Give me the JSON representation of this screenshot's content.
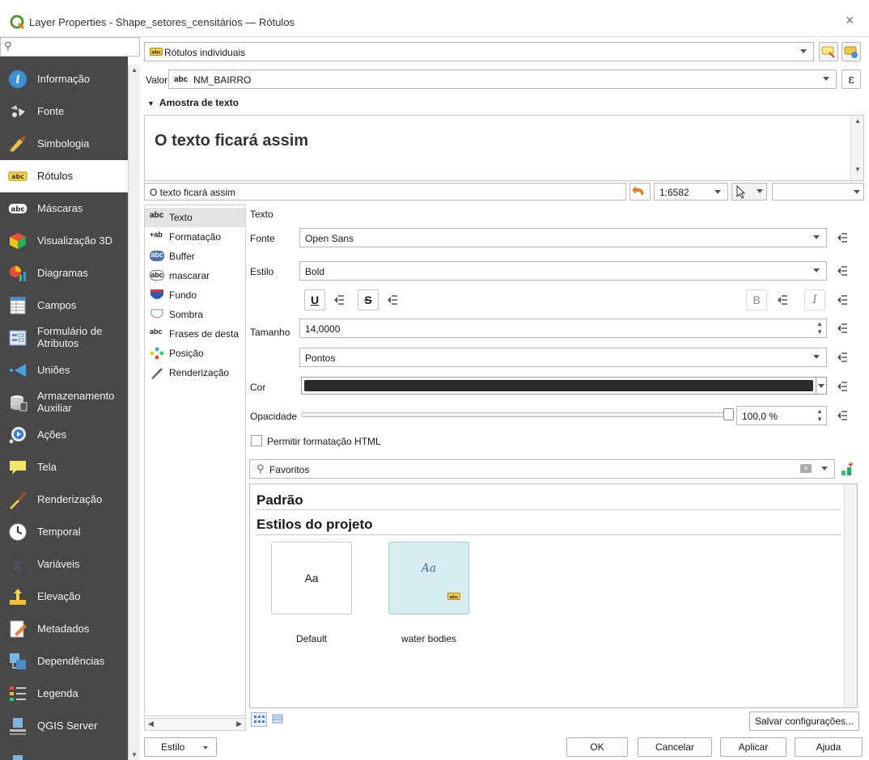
{
  "window": {
    "title": "Layer Properties - Shape_setores_censitários — Rótulos",
    "search_placeholder": ""
  },
  "sidebar": {
    "items": [
      {
        "label": "Informação",
        "icon": "info-icon"
      },
      {
        "label": "Fonte",
        "icon": "source-icon"
      },
      {
        "label": "Simbologia",
        "icon": "symbology-icon"
      },
      {
        "label": "Rótulos",
        "icon": "labels-icon"
      },
      {
        "label": "Máscaras",
        "icon": "masks-icon"
      },
      {
        "label": "Visualização 3D",
        "icon": "3d-icon"
      },
      {
        "label": "Diagramas",
        "icon": "diagrams-icon"
      },
      {
        "label": "Campos",
        "icon": "fields-icon"
      },
      {
        "label": "Formulário de",
        "label2": "Atributos",
        "icon": "form-icon"
      },
      {
        "label": "Uniões",
        "icon": "joins-icon"
      },
      {
        "label": "Armazenamento",
        "label2": "Auxiliar",
        "icon": "storage-icon"
      },
      {
        "label": "Ações",
        "icon": "actions-icon"
      },
      {
        "label": "Tela",
        "icon": "display-icon"
      },
      {
        "label": "Renderização",
        "icon": "rendering-icon"
      },
      {
        "label": "Temporal",
        "icon": "temporal-icon"
      },
      {
        "label": "Variáveis",
        "icon": "variables-icon"
      },
      {
        "label": "Elevação",
        "icon": "elevation-icon"
      },
      {
        "label": "Metadados",
        "icon": "metadata-icon"
      },
      {
        "label": "Dependências",
        "icon": "dependencies-icon"
      },
      {
        "label": "Legenda",
        "icon": "legend-icon"
      },
      {
        "label": "QGIS Server",
        "icon": "server-icon"
      }
    ],
    "active": "Rótulos"
  },
  "labels": {
    "mode": "Rótulos individuais",
    "value_label": "Valor",
    "value_field": "NM_BAIRRO",
    "sample_heading": "Amostra de texto",
    "preview_text": "O texto ficará assim",
    "preview_input": "O texto ficará assim",
    "scale": "1:6582"
  },
  "subtree": {
    "items": [
      {
        "label": "Texto",
        "icon": "abc"
      },
      {
        "label": "Formatação",
        "icon": "+ab"
      },
      {
        "label": "Buffer",
        "icon": "abc"
      },
      {
        "label": "mascarar",
        "icon": "abc"
      },
      {
        "label": "Fundo",
        "icon": "background-icon"
      },
      {
        "label": "Sombra",
        "icon": "shadow-icon"
      },
      {
        "label": "Frases de desta",
        "icon": "abc"
      },
      {
        "label": "Posição",
        "icon": "placement-icon"
      },
      {
        "label": "Renderização",
        "icon": "rendering-icon"
      }
    ]
  },
  "text_panel": {
    "section": "Texto",
    "font_label": "Fonte",
    "font_value": "Open Sans",
    "style_label": "Estilo",
    "style_value": "Bold",
    "u_label": "U",
    "s_label": "S",
    "b_label": "B",
    "i_label": "I",
    "size_label": "Tamanho",
    "size_value": "14,0000",
    "unit_value": "Pontos",
    "color_label": "Cor",
    "opacity_label": "Opacidade",
    "opacity": 100,
    "opacity_value": "100,0 %",
    "html_label": "Permitir formatação HTML",
    "search_value": "Favoritos"
  },
  "gallery": {
    "group1": "Padrão",
    "group2": "Estilos do projeto",
    "tiles": [
      {
        "sample": "Aa",
        "name": "Default"
      },
      {
        "sample": "Aa",
        "name": "water bodies"
      }
    ],
    "save_button": "Salvar configurações..."
  },
  "footer": {
    "style_button": "Estilo",
    "ok": "OK",
    "cancel": "Cancelar",
    "apply": "Aplicar",
    "help": "Ajuda"
  },
  "colors": {
    "sidebar_bg": "#484848",
    "text_color": "#2b2b2b",
    "tile_selected": "#d6eef2"
  }
}
